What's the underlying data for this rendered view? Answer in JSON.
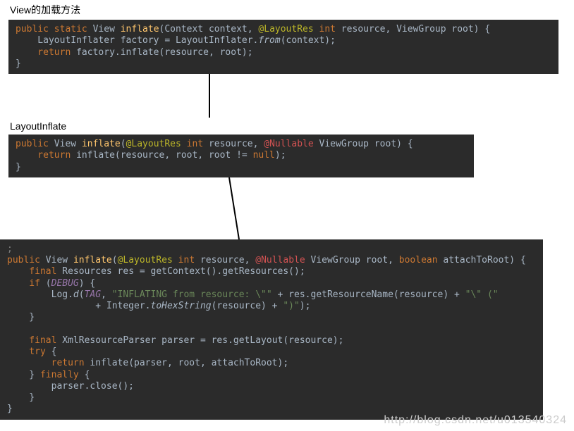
{
  "labels": {
    "top": "View的加载方法",
    "mid": "LayoutInflate"
  },
  "block1": {
    "l1_public": "public",
    "l1_static": "static",
    "l1_rettype": "View",
    "l1_method": "inflate",
    "l1_sig_a": "(Context context, ",
    "l1_ann": "@LayoutRes",
    "l1_int": " int",
    "l1_sig_b": " resource, ViewGroup root) {",
    "l2": "    LayoutInflater factory = LayoutInflater.",
    "l2_from": "from",
    "l2_tail": "(context);",
    "l3_ret": "    return",
    "l3_rest": " factory.inflate(resource, root);",
    "l4": "}"
  },
  "block2": {
    "l1_public": "public",
    "l1_rettype": " View ",
    "l1_method": "inflate",
    "l1_open": "(",
    "l1_ann1": "@LayoutRes",
    "l1_int": " int",
    "l1_mid": " resource, ",
    "l1_ann2": "@Nullable",
    "l1_tail": " ViewGroup root) {",
    "l2_ret": "    return",
    "l2_rest": " inflate(resource, root, root != ",
    "l2_null": "null",
    "l2_end": ");",
    "l3": "}"
  },
  "block3": {
    "l0": ";",
    "l1_public": "public",
    "l1_rettype": " View ",
    "l1_method": "inflate",
    "l1_open": "(",
    "l1_ann1": "@LayoutRes",
    "l1_int": " int",
    "l1_mid": " resource, ",
    "l1_ann2": "@Nullable",
    "l1_mid2": " ViewGroup root, ",
    "l1_bool": "boolean",
    "l1_tail": " attachToRoot) {",
    "l2_final": "    final",
    "l2_rest": " Resources res = getContext().getResources();",
    "l3_if": "    if",
    "l3_open": " (",
    "l3_debug": "DEBUG",
    "l3_close": ") {",
    "l4_a": "        Log.",
    "l4_d": "d",
    "l4_open": "(",
    "l4_tag": "TAG",
    "l4_comma": ", ",
    "l4_str1": "\"INFLATING from resource: \\\"\"",
    "l4_plus": " + res.getResourceName(resource) + ",
    "l4_str2": "\"\\\" (\"",
    "l5_a": "                + Integer.",
    "l5_tohex": "toHexString",
    "l5_b": "(resource) + ",
    "l5_str": "\")\"",
    "l5_end": ");",
    "l6": "    }",
    "blank": "",
    "l7_final": "    final",
    "l7_rest": " XmlResourceParser parser = res.getLayout(resource);",
    "l8_try": "    try",
    "l8_brace": " {",
    "l9_ret": "        return",
    "l9_rest": " inflate(parser, root, attachToRoot);",
    "l10_a": "    } ",
    "l10_fin": "finally",
    "l10_b": " {",
    "l11": "        parser.close();",
    "l12": "    }",
    "l13": "}"
  },
  "watermark": "http://blog.csdn.net/u013540324"
}
